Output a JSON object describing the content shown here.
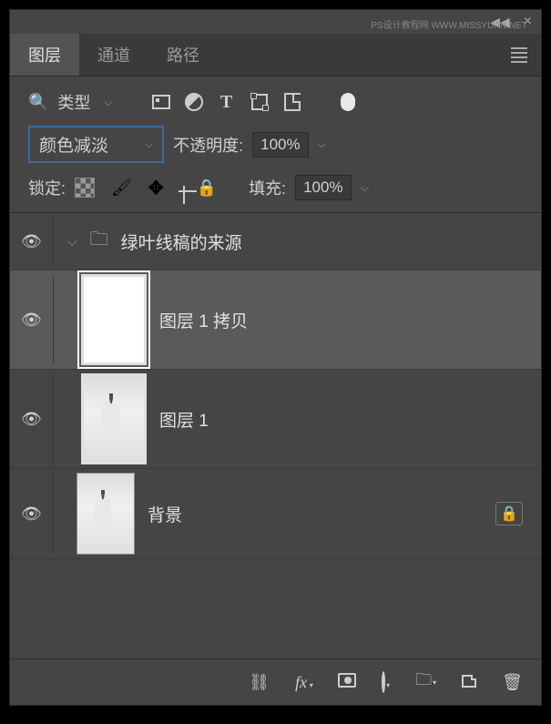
{
  "watermark": "PS设计教程网 WWW.MISSYUAN.NET",
  "tabs": {
    "layers": "图层",
    "channels": "通道",
    "paths": "路径"
  },
  "filter": {
    "kind_label": "类型"
  },
  "blend": {
    "mode": "颜色减淡",
    "opacity_label": "不透明度:",
    "opacity_value": "100%"
  },
  "lock": {
    "label": "锁定:",
    "fill_label": "填充:",
    "fill_value": "100%"
  },
  "layers": {
    "group_name": "绿叶线稿的来源",
    "layer_copy": "图层 1 拷贝",
    "layer1": "图层 1",
    "background": "背景"
  }
}
